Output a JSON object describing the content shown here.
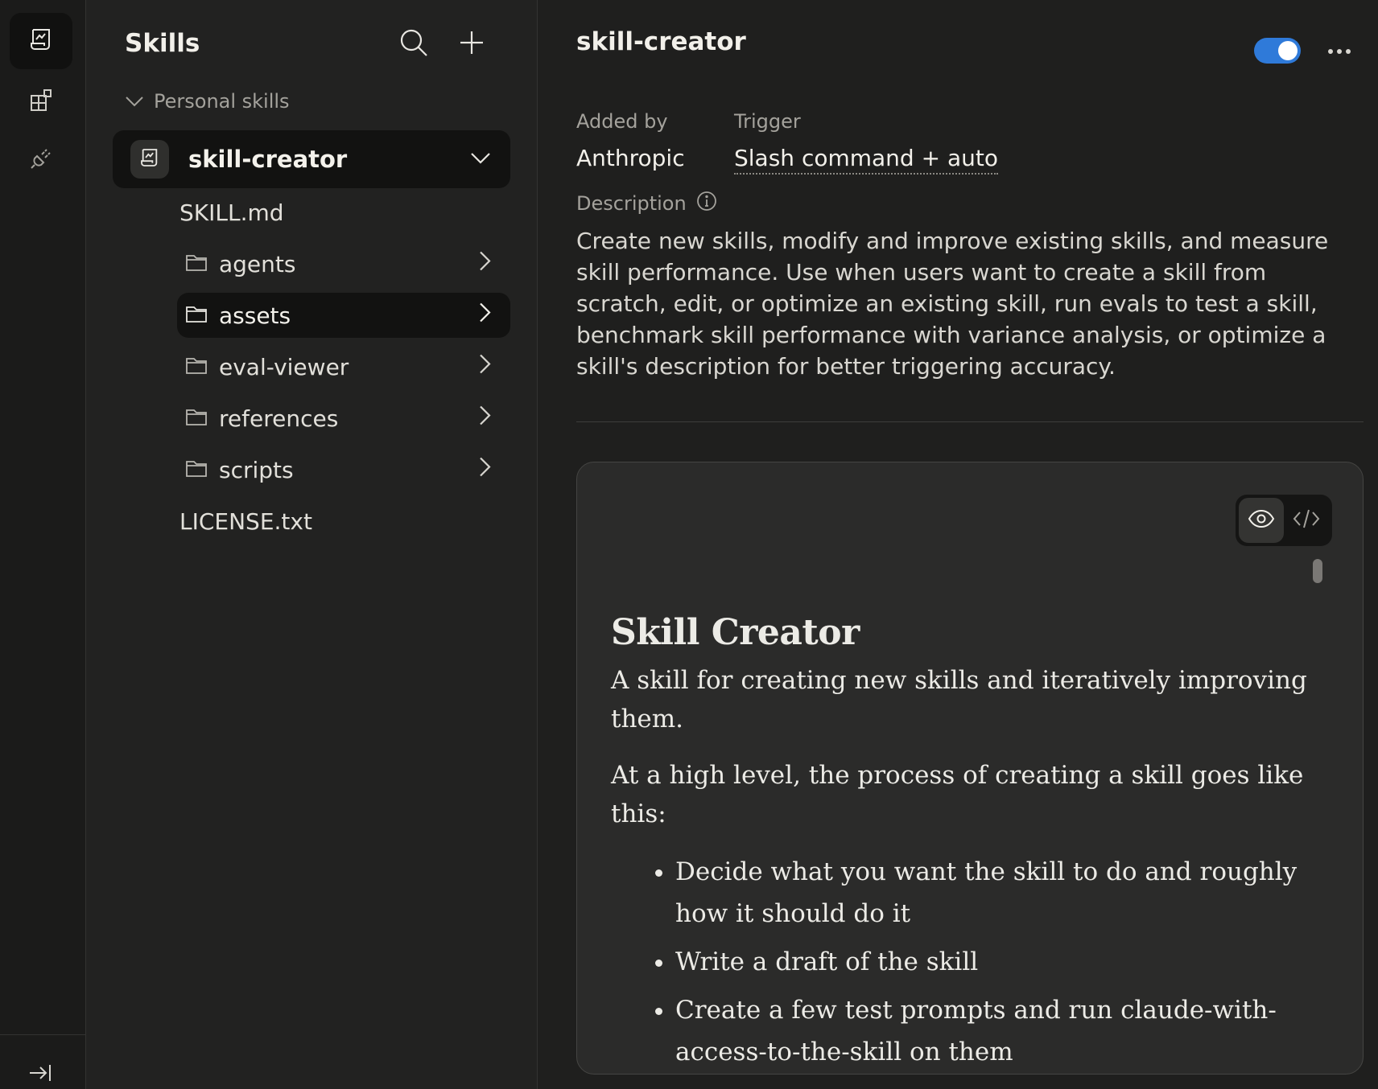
{
  "rail": {
    "items": [
      {
        "name": "skills",
        "icon": "scroll-icon",
        "active": true
      },
      {
        "name": "connectors",
        "icon": "blocks-icon",
        "active": false
      },
      {
        "name": "plugins",
        "icon": "plug-icon",
        "active": false
      }
    ],
    "bottom_icon": "collapse-arrow-icon"
  },
  "panel": {
    "title": "Skills",
    "section_label": "Personal skills",
    "skill": {
      "name": "skill-creator",
      "icon": "scroll-icon"
    },
    "files": {
      "skill_md": "SKILL.md",
      "license": "LICENSE.txt"
    },
    "folders": [
      {
        "label": "agents",
        "selected": false
      },
      {
        "label": "assets",
        "selected": true
      },
      {
        "label": "eval-viewer",
        "selected": false
      },
      {
        "label": "references",
        "selected": false
      },
      {
        "label": "scripts",
        "selected": false
      }
    ]
  },
  "main": {
    "title": "skill-creator",
    "toggle_on": true,
    "added_by_label": "Added by",
    "added_by_value": "Anthropic",
    "trigger_label": "Trigger",
    "trigger_value": "Slash command + auto",
    "description_label": "Description",
    "description": "Create new skills, modify and improve existing skills, and measure skill performance. Use when users want to create a skill from scratch, edit, or optimize an existing skill, run evals to test a skill, benchmark skill performance with variance analysis, or optimize a skill's description for better triggering accuracy."
  },
  "preview": {
    "view_modes": [
      "preview-eye-icon",
      "code-icon"
    ],
    "active_mode": "preview",
    "heading": "Skill Creator",
    "intro": "A skill for creating new skills and iteratively improving them.",
    "lead": "At a high level, the process of creating a skill goes like this:",
    "bullets": [
      "Decide what you want the skill to do and roughly how it should do it",
      "Write a draft of the skill",
      "Create a few test prompts and run claude-with-access-to-the-skill on them"
    ]
  },
  "colors": {
    "accent_toggle": "#2f7ad9",
    "background": "#1f1f1e",
    "selected_row": "#121211"
  }
}
